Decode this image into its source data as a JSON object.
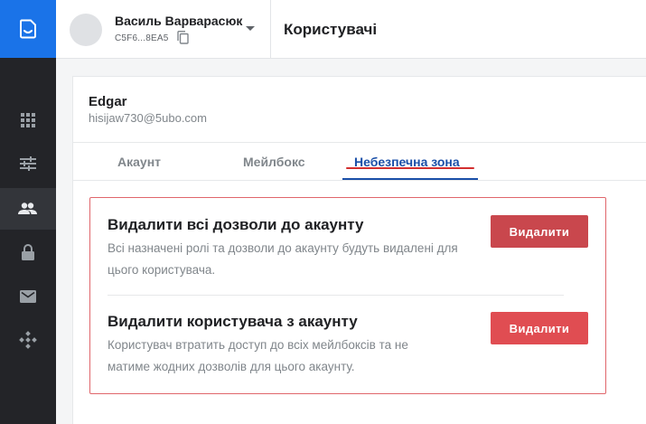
{
  "sidebar": {
    "logo": "app-logo-icon",
    "items": [
      {
        "icon": "grid-icon",
        "active": false
      },
      {
        "icon": "sliders-icon",
        "active": false
      },
      {
        "icon": "users-icon",
        "active": true
      },
      {
        "icon": "lock-icon",
        "active": false
      },
      {
        "icon": "mail-icon",
        "active": false
      },
      {
        "icon": "integrations-icon",
        "active": false
      }
    ]
  },
  "header": {
    "account_name": "Василь Варварасюк",
    "account_id": "C5F6...8EA5",
    "page_title": "Користувачі"
  },
  "user": {
    "name": "Edgar",
    "email": "hisijaw730@5ubo.com"
  },
  "tabs": [
    {
      "label": "Акаунт",
      "active": false
    },
    {
      "label": "Мейлбокс",
      "active": false
    },
    {
      "label": "Небезпечна зона",
      "active": true
    }
  ],
  "danger_zone": {
    "sections": [
      {
        "title": "Видалити всі дозволи до акаунту",
        "description": "Всі назначені ролі та дозволи до акаунту будуть видалені для цього користувача.",
        "button_label": "Видалити"
      },
      {
        "title": "Видалити користувача з акаунту",
        "description": "Користувач втратить доступ до всіх мейлбоксів та не матиме жодних дозволів для цього акаунту.",
        "button_label": "Видалити"
      }
    ]
  },
  "colors": {
    "primary": "#1a73e8",
    "sidebar_bg": "#232428",
    "tab_active": "#1a4fa8",
    "danger_border": "#e0666b",
    "danger_button_1": "#c9474d",
    "danger_button_2": "#e04d52"
  }
}
